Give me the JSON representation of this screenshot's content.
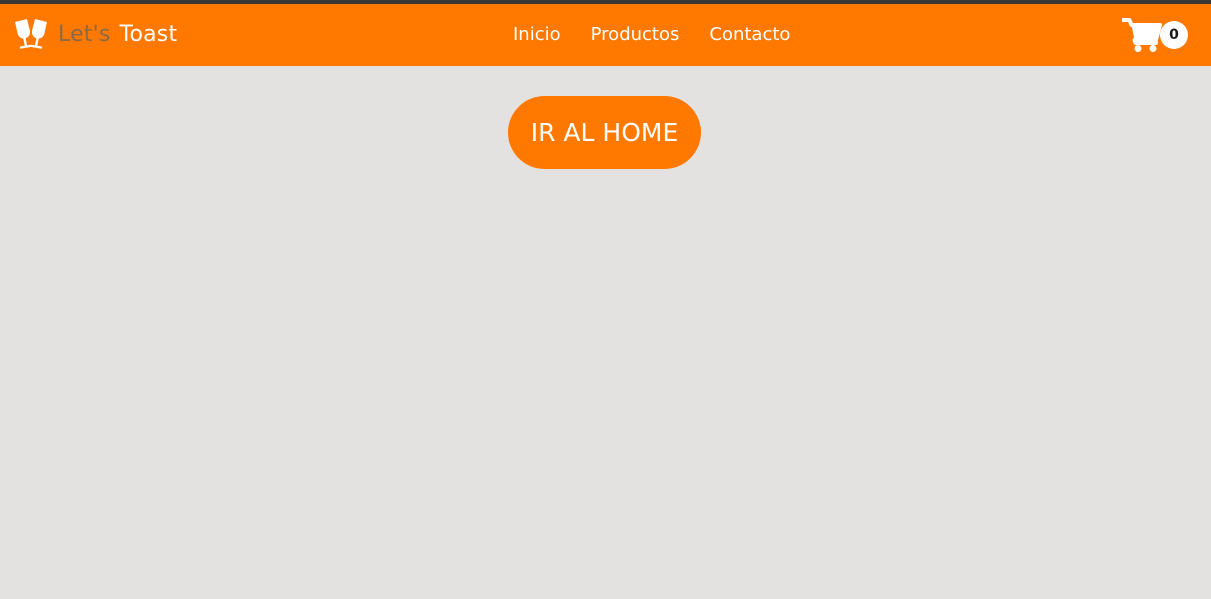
{
  "brand": {
    "icon": "glasses-toast-icon",
    "word1": "Let's",
    "word2": "Toast"
  },
  "nav": {
    "links": [
      {
        "label": "Inicio"
      },
      {
        "label": "Productos"
      },
      {
        "label": "Contacto"
      }
    ]
  },
  "cart": {
    "icon": "cart-icon",
    "count": "0"
  },
  "main": {
    "home_button_label": "IR AL HOME"
  },
  "colors": {
    "accent": "#ff7800",
    "background": "#e4e2e0",
    "brand_secondary_text": "#8a6a44"
  }
}
